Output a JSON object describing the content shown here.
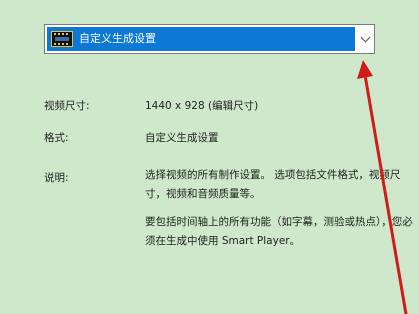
{
  "preset": {
    "selected_label": "自定义生成设置"
  },
  "info": {
    "size_label": "视频尺寸:",
    "size_value": "1440 x 928 (编辑尺寸)",
    "format_label": "格式:",
    "format_value": "自定义生成设置",
    "desc_label": "说明:",
    "desc_para1": "选择视频的所有制作设置。 选项包括文件格式，视频尺寸，视频和音频质量等。",
    "desc_para2": "要包括时间轴上的所有功能（如字幕，测验或热点），您必须在生成中使用 Smart Player。"
  },
  "colors": {
    "background": "#cfe8cc",
    "selection": "#0d78d6",
    "annotation_arrow": "#d11a1a"
  },
  "icons": {
    "preset": "film-strip-icon",
    "dropdown": "chevron-down-icon",
    "annotation": "red-arrow-icon"
  }
}
